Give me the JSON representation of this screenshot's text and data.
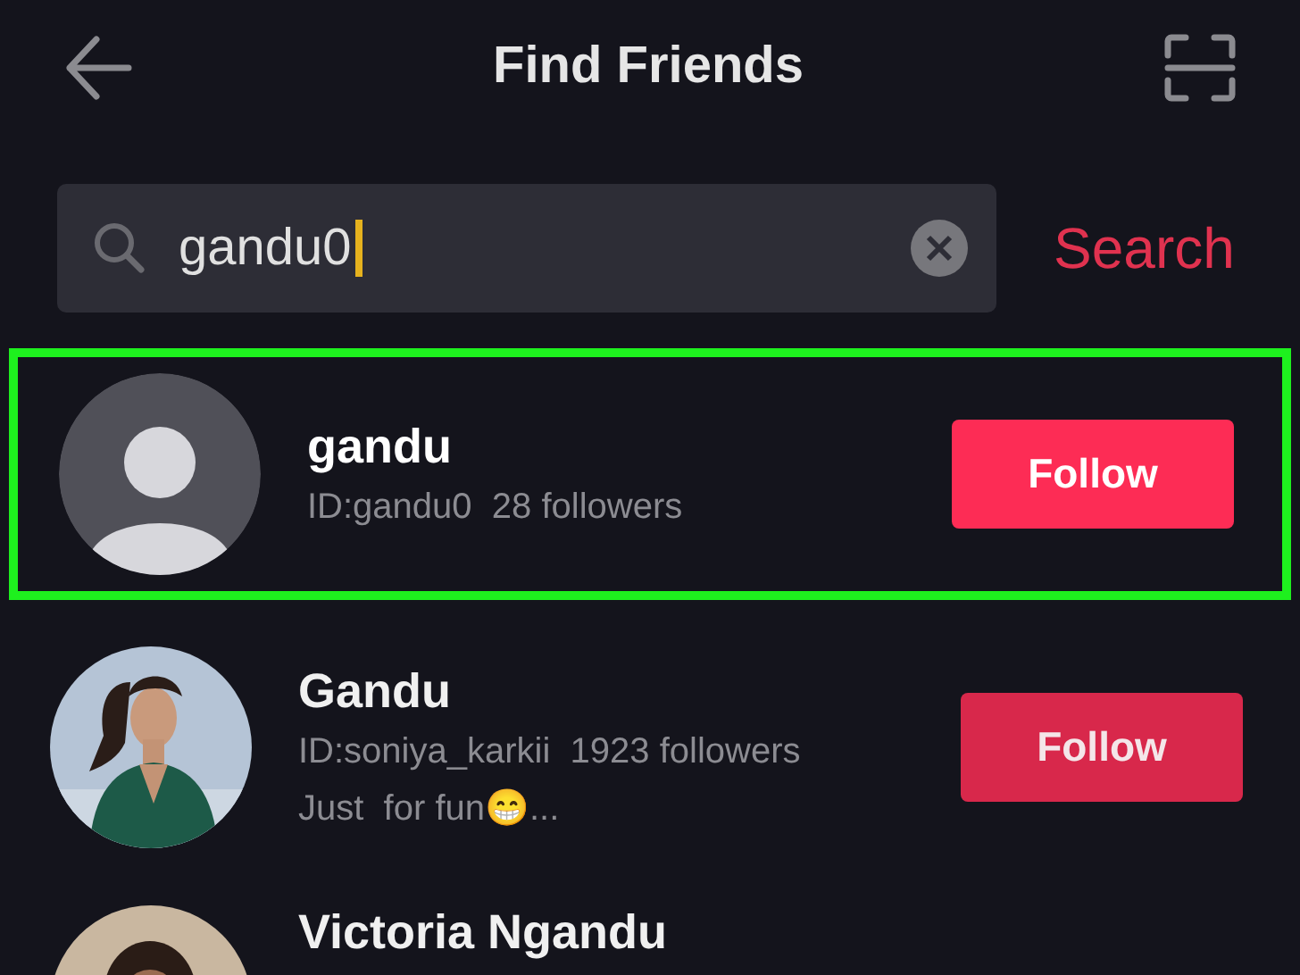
{
  "header": {
    "title": "Find Friends"
  },
  "search": {
    "value": "gandu0",
    "focused": true,
    "action": "Search"
  },
  "results": [
    {
      "name": "gandu",
      "id": "ID:gandu0",
      "followers": "28 followers",
      "kind": "avatar",
      "highlighted": true,
      "button": "Follow"
    },
    {
      "name": "Gandu",
      "id": "ID:soniya_karkii",
      "followers": "1923 followers",
      "bio": "Just  for fun😁...",
      "kind": "picture",
      "highlighted": false,
      "button": "Follow"
    },
    {
      "name": "Victoria Ngandu",
      "kind": "picture",
      "highlighted": false
    }
  ]
}
